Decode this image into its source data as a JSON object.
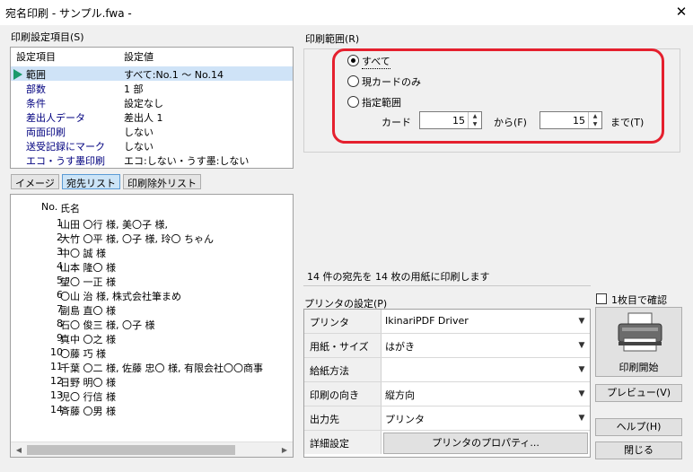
{
  "window": {
    "title": "宛名印刷 - サンプル.fwa -",
    "close_glyph": "✕"
  },
  "settings": {
    "group_label": "印刷設定項目(S)",
    "col_item": "設定項目",
    "col_value": "設定値",
    "rows": [
      {
        "key": "範囲",
        "value": "すべて:No.1 ～ No.14"
      },
      {
        "key": "部数",
        "value": "1 部"
      },
      {
        "key": "条件",
        "value": "設定なし"
      },
      {
        "key": "差出人データ",
        "value": "差出人 1"
      },
      {
        "key": "両面印刷",
        "value": "しない"
      },
      {
        "key": "送受記録にマーク",
        "value": "しない"
      },
      {
        "key": "エコ・うす墨印刷",
        "value": "エコ:しない・うす墨:しない"
      }
    ]
  },
  "tabs": [
    {
      "label": "イメージ"
    },
    {
      "label": "宛先リスト"
    },
    {
      "label": "印刷除外リスト"
    }
  ],
  "list": {
    "col_no": "No.",
    "col_name": "氏名",
    "items": [
      {
        "no": "1",
        "name": "山田 〇行 様, 美〇子 様,"
      },
      {
        "no": "2",
        "name": "大竹 〇平 様, 〇子 様, 玲〇 ちゃん"
      },
      {
        "no": "3",
        "name": "中〇 誠 様"
      },
      {
        "no": "4",
        "name": "山本 隆〇 様"
      },
      {
        "no": "5",
        "name": "望〇 一正 様"
      },
      {
        "no": "6",
        "name": "〇山 治 様, 株式会社筆まめ"
      },
      {
        "no": "7",
        "name": "副島 直〇 様"
      },
      {
        "no": "8",
        "name": "石〇 俊三 様, 〇子 様"
      },
      {
        "no": "9",
        "name": "真中 〇之 様"
      },
      {
        "no": "10",
        "name": "〇藤 巧 様"
      },
      {
        "no": "11",
        "name": "千葉 〇二 様, 佐藤 忠〇 様, 有限会社〇〇商事"
      },
      {
        "no": "12",
        "name": "日野 明〇 様"
      },
      {
        "no": "13",
        "name": "児〇 行信 様"
      },
      {
        "no": "14",
        "name": "斉藤 〇男 様"
      }
    ]
  },
  "range": {
    "group_label": "印刷範囲(R)",
    "options": [
      {
        "label": "すべて",
        "selected": true
      },
      {
        "label": "現カードのみ",
        "selected": false
      },
      {
        "label": "指定範囲",
        "selected": false
      }
    ],
    "card_label": "カード",
    "from_value": "15",
    "from_label": "から(F)",
    "to_value": "15",
    "to_label": "まで(T)",
    "highlight_color": "#e5202e"
  },
  "summary": "14 件の宛先を 14 枚の用紙に印刷します",
  "printer": {
    "group_label": "プリンタの設定(P)",
    "rows": [
      {
        "key": "プリンタ",
        "value": "IkinariPDF Driver"
      },
      {
        "key": "用紙・サイズ",
        "value": "はがき"
      },
      {
        "key": "給紙方法",
        "value": ""
      },
      {
        "key": "印刷の向き",
        "value": "縦方向"
      },
      {
        "key": "出力先",
        "value": "プリンタ"
      },
      {
        "key": "詳細設定",
        "value": ""
      }
    ],
    "properties_button": "プリンタのプロパティ..."
  },
  "right_panel": {
    "confirm_first": "1枚目で確認",
    "print_button": "印刷開始",
    "preview_button": "プレビュー(V)",
    "help_button": "ヘルプ(H)",
    "close_button": "閉じる"
  }
}
